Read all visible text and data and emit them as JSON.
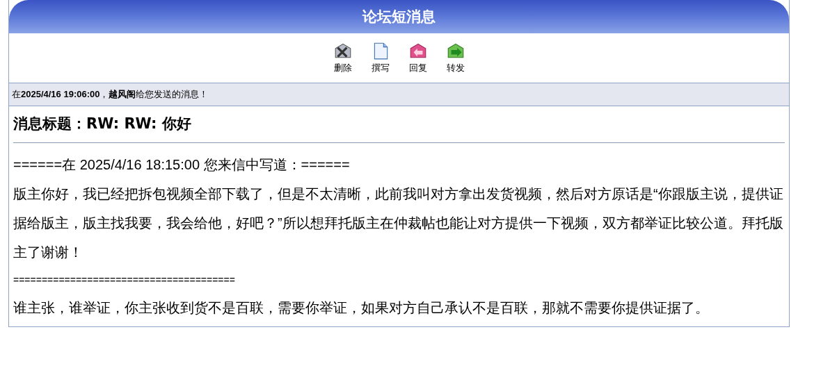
{
  "header": {
    "title": "论坛短消息"
  },
  "toolbar": [
    {
      "kind": "delete",
      "label": "删除"
    },
    {
      "kind": "compose",
      "label": "撰写"
    },
    {
      "kind": "reply",
      "label": "回复"
    },
    {
      "kind": "forward",
      "label": "转发"
    }
  ],
  "info": "在**2025/4/16 19:06:00**，**越风阁**给您发送的消息！",
  "subject": "消息标题：RW: RW: 你好",
  "body": [
    "======在 2025/4/16 18:15:00 您来信中写道：======",
    "版主你好，我已经把拆包视频全部下载了，但是不太清晰，此前我叫对方拿出发货视频，然后对方原话是“你跟版主说，提供证据给版主，版主找我要，我会给他，好吧？”所以想拜托版主在仲裁帖也能让对方提供一下视频，双方都举证比较公道。拜托版主了谢谢！",
    "=======================================",
    "谁主张，谁举证，你主张收到货不是百联，需要你举证，如果对方自己承认不是百联，那就不需要你提供证据了。"
  ]
}
